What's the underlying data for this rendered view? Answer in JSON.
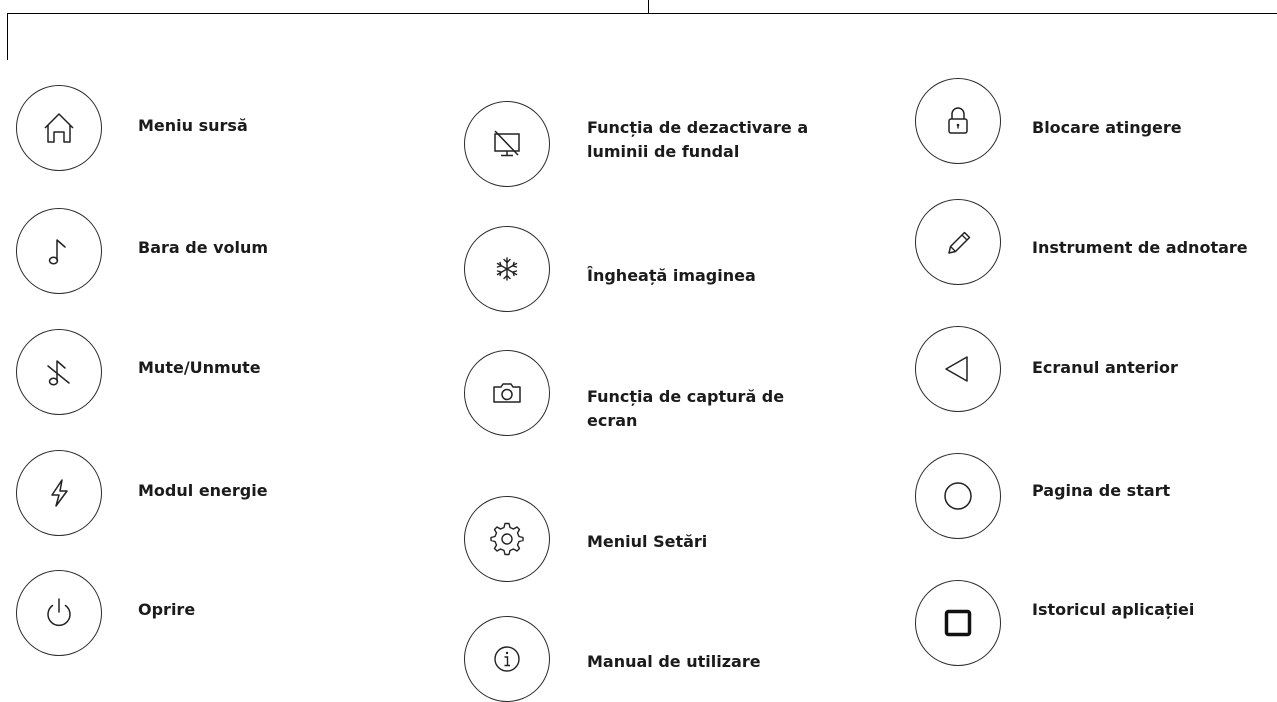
{
  "columns": [
    {
      "items": [
        {
          "icon": "home-icon",
          "label": "Meniu sursă"
        },
        {
          "icon": "music-note-icon",
          "label": "Bara de volum"
        },
        {
          "icon": "mute-icon",
          "label": "Mute/Unmute"
        },
        {
          "icon": "lightning-icon",
          "label": "Modul energie"
        },
        {
          "icon": "power-icon",
          "label": "Oprire"
        }
      ]
    },
    {
      "items": [
        {
          "icon": "backlight-off-icon",
          "label": "Funcția de dezactivare a",
          "label2": "luminii de fundal"
        },
        {
          "icon": "snowflake-icon",
          "label": "Îngheață imaginea"
        },
        {
          "icon": "camera-icon",
          "label": "Funcția de captură de",
          "label2": "ecran"
        },
        {
          "icon": "gear-icon",
          "label": "Meniul Setări"
        },
        {
          "icon": "info-icon",
          "label": "Manual de utilizare"
        }
      ]
    },
    {
      "items": [
        {
          "icon": "lock-icon",
          "label": "Blocare atingere"
        },
        {
          "icon": "pencil-icon",
          "label": "Instrument de adnotare"
        },
        {
          "icon": "back-triangle-icon",
          "label": "Ecranul anterior"
        },
        {
          "icon": "home-circle-icon",
          "label": "Pagina de start"
        },
        {
          "icon": "recent-apps-icon",
          "label": "Istoricul aplicației"
        }
      ]
    }
  ]
}
